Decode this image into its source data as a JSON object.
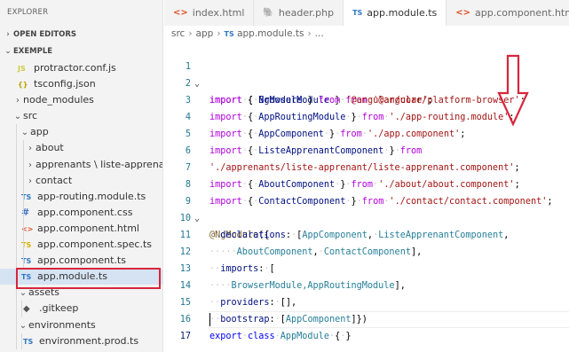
{
  "explorer": {
    "title": "EXPLORER",
    "open_editors": "OPEN EDITORS",
    "project": "EXEMPLE",
    "items": [
      {
        "label": "protractor.conf.js",
        "type": "js",
        "icon": "JS"
      },
      {
        "label": "tsconfig.json",
        "type": "json",
        "icon": "{}"
      },
      {
        "label": "node_modules",
        "type": "folder",
        "chevron": ">"
      },
      {
        "label": "src",
        "type": "folder",
        "chevron": "v"
      },
      {
        "label": "app",
        "type": "folder",
        "chevron": "v"
      },
      {
        "label": "about",
        "type": "folder",
        "chevron": ">"
      },
      {
        "label": "apprenants \\ liste-apprenant",
        "type": "folder",
        "chevron": ">"
      },
      {
        "label": "contact",
        "type": "folder",
        "chevron": ">"
      },
      {
        "label": "app-routing.module.ts",
        "type": "ts",
        "icon": "TS"
      },
      {
        "label": "app.component.css",
        "type": "css",
        "icon": "#"
      },
      {
        "label": "app.component.html",
        "type": "html",
        "icon": "<>"
      },
      {
        "label": "app.component.spec.ts",
        "type": "tsspec",
        "icon": "TS"
      },
      {
        "label": "app.component.ts",
        "type": "ts",
        "icon": "TS"
      },
      {
        "label": "app.module.ts",
        "type": "ts",
        "icon": "TS"
      },
      {
        "label": "assets",
        "type": "folder",
        "chevron": ">"
      },
      {
        "label": ".gitkeep",
        "type": "git",
        "icon": "◆"
      },
      {
        "label": "environments",
        "type": "folder",
        "chevron": "v"
      },
      {
        "label": "environment.prod.ts",
        "type": "ts",
        "icon": "TS"
      }
    ]
  },
  "tabs": [
    {
      "label": "index.html",
      "icon": "<>"
    },
    {
      "label": "header.php",
      "icon": "php"
    },
    {
      "label": "app.module.ts",
      "icon": "TS"
    },
    {
      "label": "app.component.html",
      "icon": "<>"
    }
  ],
  "breadcrumb": {
    "part1": "src",
    "part2": "app",
    "file_icon": "TS",
    "file": "app.module.ts",
    "tail": "..."
  },
  "code_lines": [
    "1",
    "2",
    "3",
    "4",
    "5",
    "6",
    "7",
    "8",
    "9",
    "10",
    "11",
    "12",
    "13",
    "14",
    "15",
    "16",
    "17"
  ],
  "code": {
    "l1_mod": "BrowserModule",
    "l1_path": "'@angular/platform-browser'",
    "l2_mod": "NgModule",
    "l2_path": "'@angular/core'",
    "l3_mod": "AppRoutingModule",
    "l3_path": "'./app-routing.module'",
    "l4_mod": "AppComponent",
    "l4_path": "'./app.component'",
    "l5_mod": "ListeApprenantComponent",
    "l6_path": "'./apprenants/liste-apprenant/liste-apprenant.component'",
    "l7_mod": "AboutComponent",
    "l7_path": "'./about/about.component'",
    "l8_mod": "ContactComponent",
    "l8_path": "'./contact/contact.component'",
    "l9_dec": "@NgModule",
    "l10_a": "AppComponent",
    "l10_b": "ListeApprenantComponent",
    "l11_a": "AboutComponent",
    "l11_b": "ContactComponent",
    "l13_mods": "BrowserModule,AppRoutingModule",
    "l15_boot": "AppComponent",
    "l16_class": "AppModule",
    "kw_import": "import",
    "kw_from": "from",
    "kw_export": "export",
    "kw_class": "class",
    "prop_declarations": "declarations",
    "prop_imports": "imports",
    "prop_providers": "providers",
    "prop_bootstrap": "bootstrap"
  },
  "colors": {
    "annotation_red": "#d7263d"
  }
}
